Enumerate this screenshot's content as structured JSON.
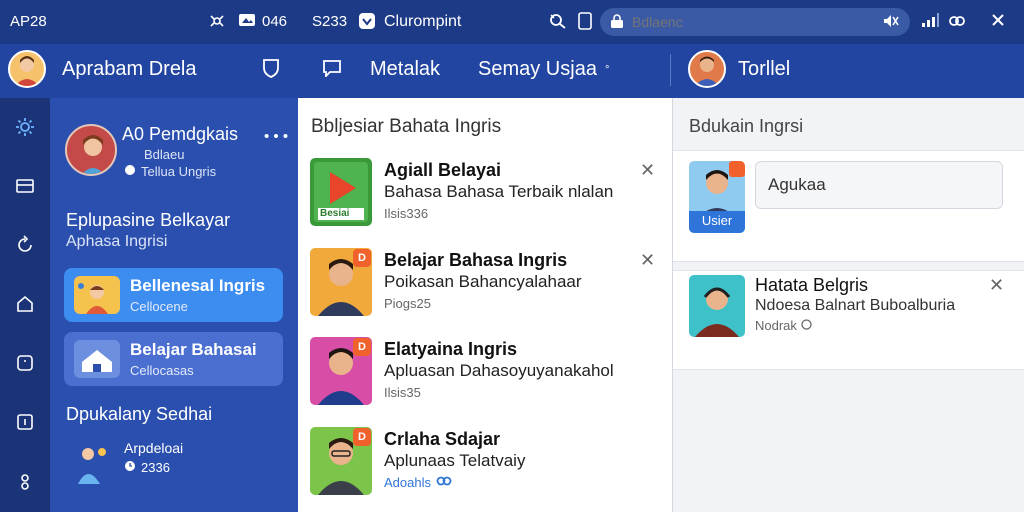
{
  "statusbar": {
    "time": "AP28",
    "left_value": "046",
    "mid_value": "S233",
    "app_name": "Clurompint",
    "search_placeholder": "Bdlaenc"
  },
  "header": {
    "title": "Aprabam Drela",
    "tab_1": "Metalak",
    "tab_2": "Semay Usjaa",
    "tab_2_badge": "°",
    "profile_name": "Torllel"
  },
  "left_panel": {
    "profile_title": "A0 Pemdgkais",
    "profile_sub": "Bdlaeu",
    "profile_meta": "Tellua Ungris",
    "section_title_1": "Eplupasine Belkayar",
    "section_title_2": "Aphasa Ingrisi",
    "cards": [
      {
        "title": "Bellenesal Ingris",
        "sub": "Cellocene"
      },
      {
        "title": "Belajar Bahasai",
        "sub": "Cellocasas"
      }
    ],
    "section2_title": "Dpukalany Sedhai",
    "bottom_title": "Arpdeloai",
    "bottom_sub": "2336"
  },
  "middle_panel": {
    "title": "Bbljesiar Bahata Ingris",
    "courses": [
      {
        "title": "Agiall Belayai",
        "desc": "Bahasa Bahasa Terbaik nlalan",
        "meta": "Ilsis336",
        "badge": "",
        "thumb_label": "Besiai"
      },
      {
        "title": "Belajar Bahasa Ingris",
        "desc": "Poikasan Bahancyalahaar",
        "meta": "Piogs25",
        "badge": "D",
        "thumb_label": ""
      },
      {
        "title": "Elatyaina Ingris",
        "desc": "Apluasan Dahasoyuyanakahol",
        "meta": "Ilsis35",
        "badge": "D",
        "thumb_label": ""
      },
      {
        "title": "Crlaha Sdajar",
        "desc": "Aplunaas Telatvaiy",
        "meta": "Adoahls",
        "badge": "D",
        "thumb_label": ""
      }
    ]
  },
  "right_panel": {
    "title": "Bdukain Ingrsi",
    "input_value": "Agukaa",
    "user_label": "Usier",
    "card_title": "Hatata Belgris",
    "card_desc": "Ndoesa Balnart Buboalburia",
    "card_meta": "Nodrak"
  },
  "colors": {
    "statusbar_bg": "#1d3a86",
    "header_bg": "#2145a0",
    "sidebar_bg": "#2a4fae",
    "rail_bg": "#1b3478",
    "card_active": "#3d8cf0",
    "card_second": "#4a6fd0",
    "badge_orange": "#f0612b",
    "link_blue": "#2f74d8"
  }
}
